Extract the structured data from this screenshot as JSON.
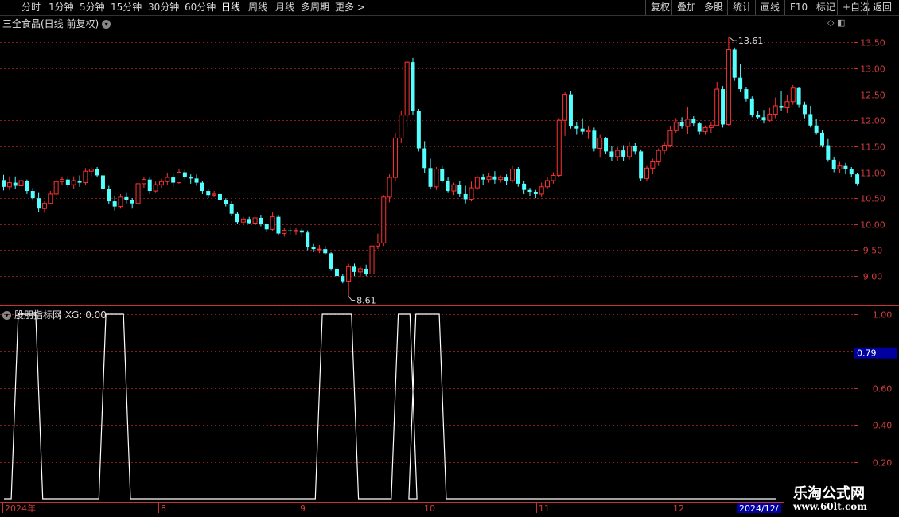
{
  "toolbar": {
    "periods": [
      "分时",
      "1分钟",
      "5分钟",
      "15分钟",
      "30分钟",
      "60分钟",
      "日线",
      "周线",
      "月线",
      "多周期",
      "更多 >"
    ],
    "active_period": "日线",
    "right_buttons": [
      "复权",
      "叠加",
      "多股",
      "统计",
      "画线",
      "F10",
      "标记",
      "+自选",
      "返回"
    ]
  },
  "main_title": "三全食品(日线 前复权)",
  "indicator_title": "股朋指标网 XG: 0.00",
  "annotations": {
    "high": "13.61",
    "low": "8.61"
  },
  "current_value_label": "0.79",
  "watermark": {
    "line1": "乐淘公式网",
    "line2": "www.60lt.com"
  },
  "colors": {
    "up": "#ff3232",
    "down": "#54ffff",
    "grid": "#8b1a1a",
    "axis": "#c83232",
    "signal": "#ffffff"
  },
  "chart_data": [
    {
      "type": "candlestick",
      "yticks": [
        9.0,
        9.5,
        10.0,
        10.5,
        11.0,
        11.5,
        12.0,
        12.5,
        13.0,
        13.5
      ],
      "ylim": [
        8.45,
        13.75
      ],
      "x_labels": [
        "2024年",
        "8",
        "9",
        "10",
        "11",
        "12",
        "2024/12/"
      ],
      "ohlc": [
        [
          10.85,
          10.95,
          10.65,
          10.72
        ],
        [
          10.72,
          10.92,
          10.66,
          10.8
        ],
        [
          10.8,
          10.92,
          10.68,
          10.74
        ],
        [
          10.74,
          10.88,
          10.64,
          10.84
        ],
        [
          10.84,
          10.86,
          10.58,
          10.64
        ],
        [
          10.64,
          10.7,
          10.45,
          10.5
        ],
        [
          10.5,
          10.6,
          10.24,
          10.3
        ],
        [
          10.3,
          10.44,
          10.22,
          10.4
        ],
        [
          10.4,
          10.64,
          10.38,
          10.58
        ],
        [
          10.58,
          10.86,
          10.55,
          10.82
        ],
        [
          10.82,
          10.92,
          10.76,
          10.86
        ],
        [
          10.86,
          10.92,
          10.7,
          10.76
        ],
        [
          10.76,
          10.92,
          10.68,
          10.84
        ],
        [
          10.84,
          10.94,
          10.72,
          10.8
        ],
        [
          10.8,
          11.08,
          10.76,
          11.02
        ],
        [
          11.02,
          11.1,
          10.9,
          11.06
        ],
        [
          11.06,
          11.1,
          10.9,
          10.94
        ],
        [
          10.94,
          10.96,
          10.62,
          10.68
        ],
        [
          10.68,
          10.74,
          10.38,
          10.44
        ],
        [
          10.44,
          10.54,
          10.26,
          10.34
        ],
        [
          10.34,
          10.58,
          10.3,
          10.52
        ],
        [
          10.52,
          10.6,
          10.4,
          10.46
        ],
        [
          10.46,
          10.5,
          10.3,
          10.4
        ],
        [
          10.4,
          10.84,
          10.36,
          10.78
        ],
        [
          10.78,
          10.9,
          10.7,
          10.86
        ],
        [
          10.86,
          10.9,
          10.58,
          10.64
        ],
        [
          10.64,
          10.82,
          10.6,
          10.76
        ],
        [
          10.76,
          10.88,
          10.7,
          10.82
        ],
        [
          10.82,
          10.98,
          10.76,
          10.9
        ],
        [
          10.9,
          10.96,
          10.72,
          10.8
        ],
        [
          10.8,
          11.06,
          10.78,
          11.0
        ],
        [
          11.0,
          11.06,
          10.86,
          10.9
        ],
        [
          10.9,
          10.96,
          10.78,
          10.88
        ],
        [
          10.88,
          10.96,
          10.74,
          10.8
        ],
        [
          10.8,
          10.84,
          10.58,
          10.64
        ],
        [
          10.64,
          10.68,
          10.5,
          10.56
        ],
        [
          10.56,
          10.64,
          10.52,
          10.58
        ],
        [
          10.58,
          10.62,
          10.42,
          10.46
        ],
        [
          10.46,
          10.5,
          10.34,
          10.38
        ],
        [
          10.38,
          10.44,
          10.16,
          10.2
        ],
        [
          10.2,
          10.24,
          10.0,
          10.04
        ],
        [
          10.04,
          10.14,
          9.98,
          10.1
        ],
        [
          10.1,
          10.14,
          10.0,
          10.02
        ],
        [
          10.02,
          10.14,
          9.98,
          10.12
        ],
        [
          10.12,
          10.18,
          9.96,
          10.0
        ],
        [
          10.0,
          10.02,
          9.84,
          9.9
        ],
        [
          9.9,
          10.24,
          9.86,
          10.14
        ],
        [
          10.14,
          10.18,
          9.78,
          9.82
        ],
        [
          9.82,
          9.92,
          9.76,
          9.88
        ],
        [
          9.88,
          9.94,
          9.8,
          9.86
        ],
        [
          9.86,
          9.92,
          9.8,
          9.88
        ],
        [
          9.88,
          9.92,
          9.76,
          9.84
        ],
        [
          9.84,
          9.88,
          9.5,
          9.56
        ],
        [
          9.56,
          9.62,
          9.46,
          9.52
        ],
        [
          9.52,
          9.6,
          9.44,
          9.52
        ],
        [
          9.52,
          9.58,
          9.4,
          9.44
        ],
        [
          9.44,
          9.46,
          9.1,
          9.14
        ],
        [
          9.14,
          9.18,
          8.96,
          9.0
        ],
        [
          9.0,
          9.04,
          8.86,
          8.9
        ],
        [
          8.9,
          9.24,
          8.61,
          9.18
        ],
        [
          9.18,
          9.24,
          9.0,
          9.08
        ],
        [
          9.08,
          9.18,
          8.98,
          9.14
        ],
        [
          9.14,
          9.22,
          9.0,
          9.04
        ],
        [
          9.04,
          9.62,
          9.0,
          9.58
        ],
        [
          9.58,
          9.82,
          9.52,
          9.64
        ],
        [
          9.64,
          10.56,
          9.58,
          10.52
        ],
        [
          10.52,
          10.96,
          10.42,
          10.9
        ],
        [
          10.9,
          11.76,
          10.84,
          11.66
        ],
        [
          11.66,
          12.18,
          11.56,
          12.1
        ],
        [
          12.1,
          13.14,
          11.86,
          13.12
        ],
        [
          13.12,
          13.2,
          12.1,
          12.18
        ],
        [
          12.18,
          12.22,
          11.4,
          11.46
        ],
        [
          11.46,
          11.6,
          10.98,
          11.08
        ],
        [
          11.08,
          11.26,
          10.68,
          10.72
        ],
        [
          10.72,
          11.1,
          10.66,
          11.06
        ],
        [
          11.06,
          11.12,
          10.8,
          10.84
        ],
        [
          10.84,
          10.9,
          10.6,
          10.64
        ],
        [
          10.64,
          10.8,
          10.56,
          10.76
        ],
        [
          10.76,
          10.84,
          10.52,
          10.58
        ],
        [
          10.58,
          10.74,
          10.4,
          10.48
        ],
        [
          10.48,
          10.82,
          10.44,
          10.7
        ],
        [
          10.7,
          10.94,
          10.66,
          10.9
        ],
        [
          10.9,
          10.96,
          10.76,
          10.86
        ],
        [
          10.86,
          10.98,
          10.8,
          10.92
        ],
        [
          10.92,
          11.02,
          10.78,
          10.86
        ],
        [
          10.86,
          10.94,
          10.8,
          10.9
        ],
        [
          10.9,
          10.96,
          10.76,
          10.84
        ],
        [
          10.84,
          11.12,
          10.8,
          11.06
        ],
        [
          11.06,
          11.1,
          10.72,
          10.78
        ],
        [
          10.78,
          10.84,
          10.58,
          10.66
        ],
        [
          10.66,
          10.7,
          10.54,
          10.62
        ],
        [
          10.62,
          10.66,
          10.5,
          10.58
        ],
        [
          10.58,
          10.8,
          10.52,
          10.72
        ],
        [
          10.72,
          10.9,
          10.68,
          10.84
        ],
        [
          10.84,
          11.0,
          10.78,
          10.94
        ],
        [
          10.94,
          12.04,
          10.9,
          12.0
        ],
        [
          12.0,
          12.54,
          11.7,
          12.5
        ],
        [
          12.5,
          12.56,
          11.84,
          11.88
        ],
        [
          11.88,
          11.96,
          11.72,
          11.84
        ],
        [
          11.84,
          12.04,
          11.72,
          11.78
        ],
        [
          11.78,
          11.88,
          11.64,
          11.8
        ],
        [
          11.8,
          11.86,
          11.4,
          11.46
        ],
        [
          11.46,
          11.72,
          11.28,
          11.66
        ],
        [
          11.66,
          11.68,
          11.36,
          11.4
        ],
        [
          11.4,
          11.5,
          11.22,
          11.3
        ],
        [
          11.3,
          11.48,
          11.22,
          11.42
        ],
        [
          11.42,
          11.52,
          11.22,
          11.3
        ],
        [
          11.3,
          11.58,
          11.24,
          11.5
        ],
        [
          11.5,
          11.56,
          11.34,
          11.4
        ],
        [
          11.4,
          11.44,
          10.84,
          10.88
        ],
        [
          10.88,
          11.12,
          10.84,
          11.08
        ],
        [
          11.08,
          11.26,
          10.96,
          11.2
        ],
        [
          11.2,
          11.46,
          11.12,
          11.42
        ],
        [
          11.42,
          11.58,
          11.34,
          11.52
        ],
        [
          11.52,
          11.88,
          11.48,
          11.8
        ],
        [
          11.8,
          12.04,
          11.76,
          11.96
        ],
        [
          11.96,
          12.06,
          11.84,
          11.88
        ],
        [
          11.88,
          12.26,
          11.74,
          12.02
        ],
        [
          12.02,
          12.08,
          11.88,
          11.94
        ],
        [
          11.94,
          11.96,
          11.72,
          11.78
        ],
        [
          11.78,
          11.9,
          11.72,
          11.86
        ],
        [
          11.86,
          11.96,
          11.76,
          11.9
        ],
        [
          11.9,
          12.74,
          11.88,
          12.6
        ],
        [
          12.6,
          12.66,
          11.86,
          11.92
        ],
        [
          11.92,
          13.61,
          11.9,
          13.36
        ],
        [
          13.36,
          13.4,
          12.76,
          12.82
        ],
        [
          12.82,
          13.08,
          12.54,
          12.6
        ],
        [
          12.6,
          12.64,
          12.36,
          12.42
        ],
        [
          12.42,
          12.46,
          12.06,
          12.1
        ],
        [
          12.1,
          12.18,
          12.02,
          12.06
        ],
        [
          12.06,
          12.2,
          11.94,
          12.0
        ],
        [
          12.0,
          12.24,
          11.96,
          12.12
        ],
        [
          12.12,
          12.44,
          12.04,
          12.28
        ],
        [
          12.28,
          12.56,
          12.18,
          12.24
        ],
        [
          12.24,
          12.48,
          12.14,
          12.36
        ],
        [
          12.36,
          12.68,
          12.3,
          12.62
        ],
        [
          12.62,
          12.64,
          12.24,
          12.3
        ],
        [
          12.3,
          12.36,
          12.04,
          12.12
        ],
        [
          12.12,
          12.28,
          11.86,
          11.9
        ],
        [
          11.9,
          12.02,
          11.72,
          11.76
        ],
        [
          11.76,
          11.82,
          11.48,
          11.52
        ],
        [
          11.52,
          11.64,
          11.2,
          11.24
        ],
        [
          11.24,
          11.3,
          11.0,
          11.06
        ],
        [
          11.06,
          11.2,
          10.98,
          11.12
        ],
        [
          11.12,
          11.18,
          10.96,
          11.06
        ],
        [
          11.06,
          11.1,
          10.9,
          10.96
        ],
        [
          10.96,
          10.98,
          10.74,
          10.78
        ]
      ]
    },
    {
      "type": "line",
      "series": [
        {
          "name": "XG",
          "segments": [
            [
              3,
              5
            ],
            [
              18,
              20
            ],
            [
              55,
              59
            ],
            [
              68,
              69
            ],
            [
              71,
              74
            ]
          ]
        }
      ],
      "yticks": [
        0.2,
        0.4,
        0.6,
        0.8,
        1.0
      ],
      "ylim": [
        0.0,
        1.0
      ],
      "current_value": 0.79
    }
  ]
}
